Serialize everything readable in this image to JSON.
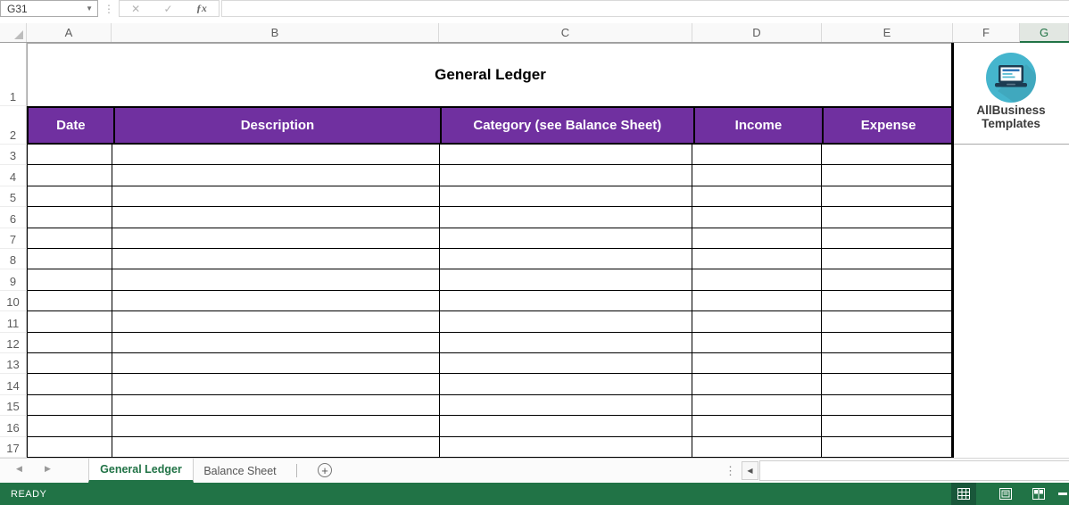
{
  "formula_bar": {
    "name_box_value": "G31",
    "formula_value": "",
    "cancel_glyph": "✕",
    "enter_glyph": "✓",
    "fx_glyph": "ƒx",
    "dropdown_glyph": "▼",
    "separator_glyph": "⋮"
  },
  "columns": [
    "A",
    "B",
    "C",
    "D",
    "E",
    "F",
    "G"
  ],
  "selected_column": "G",
  "rows": [
    "1",
    "2",
    "3",
    "4",
    "5",
    "6",
    "7",
    "8",
    "9",
    "10",
    "11",
    "12",
    "13",
    "14",
    "15",
    "16",
    "17"
  ],
  "sheet": {
    "title": "General Ledger",
    "table_headers": [
      "Date",
      "Description",
      "Category (see Balance Sheet)",
      "Income",
      "Expense"
    ],
    "empty_body_rows": 15
  },
  "logo": {
    "line1": "AllBusiness",
    "line2": "Templates"
  },
  "tabs": [
    {
      "label": "General Ledger",
      "active": true
    },
    {
      "label": "Balance Sheet",
      "active": false
    }
  ],
  "tabbar": {
    "scroll_left_glyph": "◀",
    "scroll_right_glyph": "▶",
    "add_sheet_glyph": "+",
    "handle_glyph": "⋮",
    "hscroll_left_glyph": "◀"
  },
  "status_bar": {
    "mode": "READY"
  },
  "colors": {
    "accent_green": "#217346",
    "status_bar_green": "#217346",
    "header_purple": "#7030A0",
    "logo_teal": "#45B5CD",
    "selected_column_bg": "#E2E7E2"
  }
}
